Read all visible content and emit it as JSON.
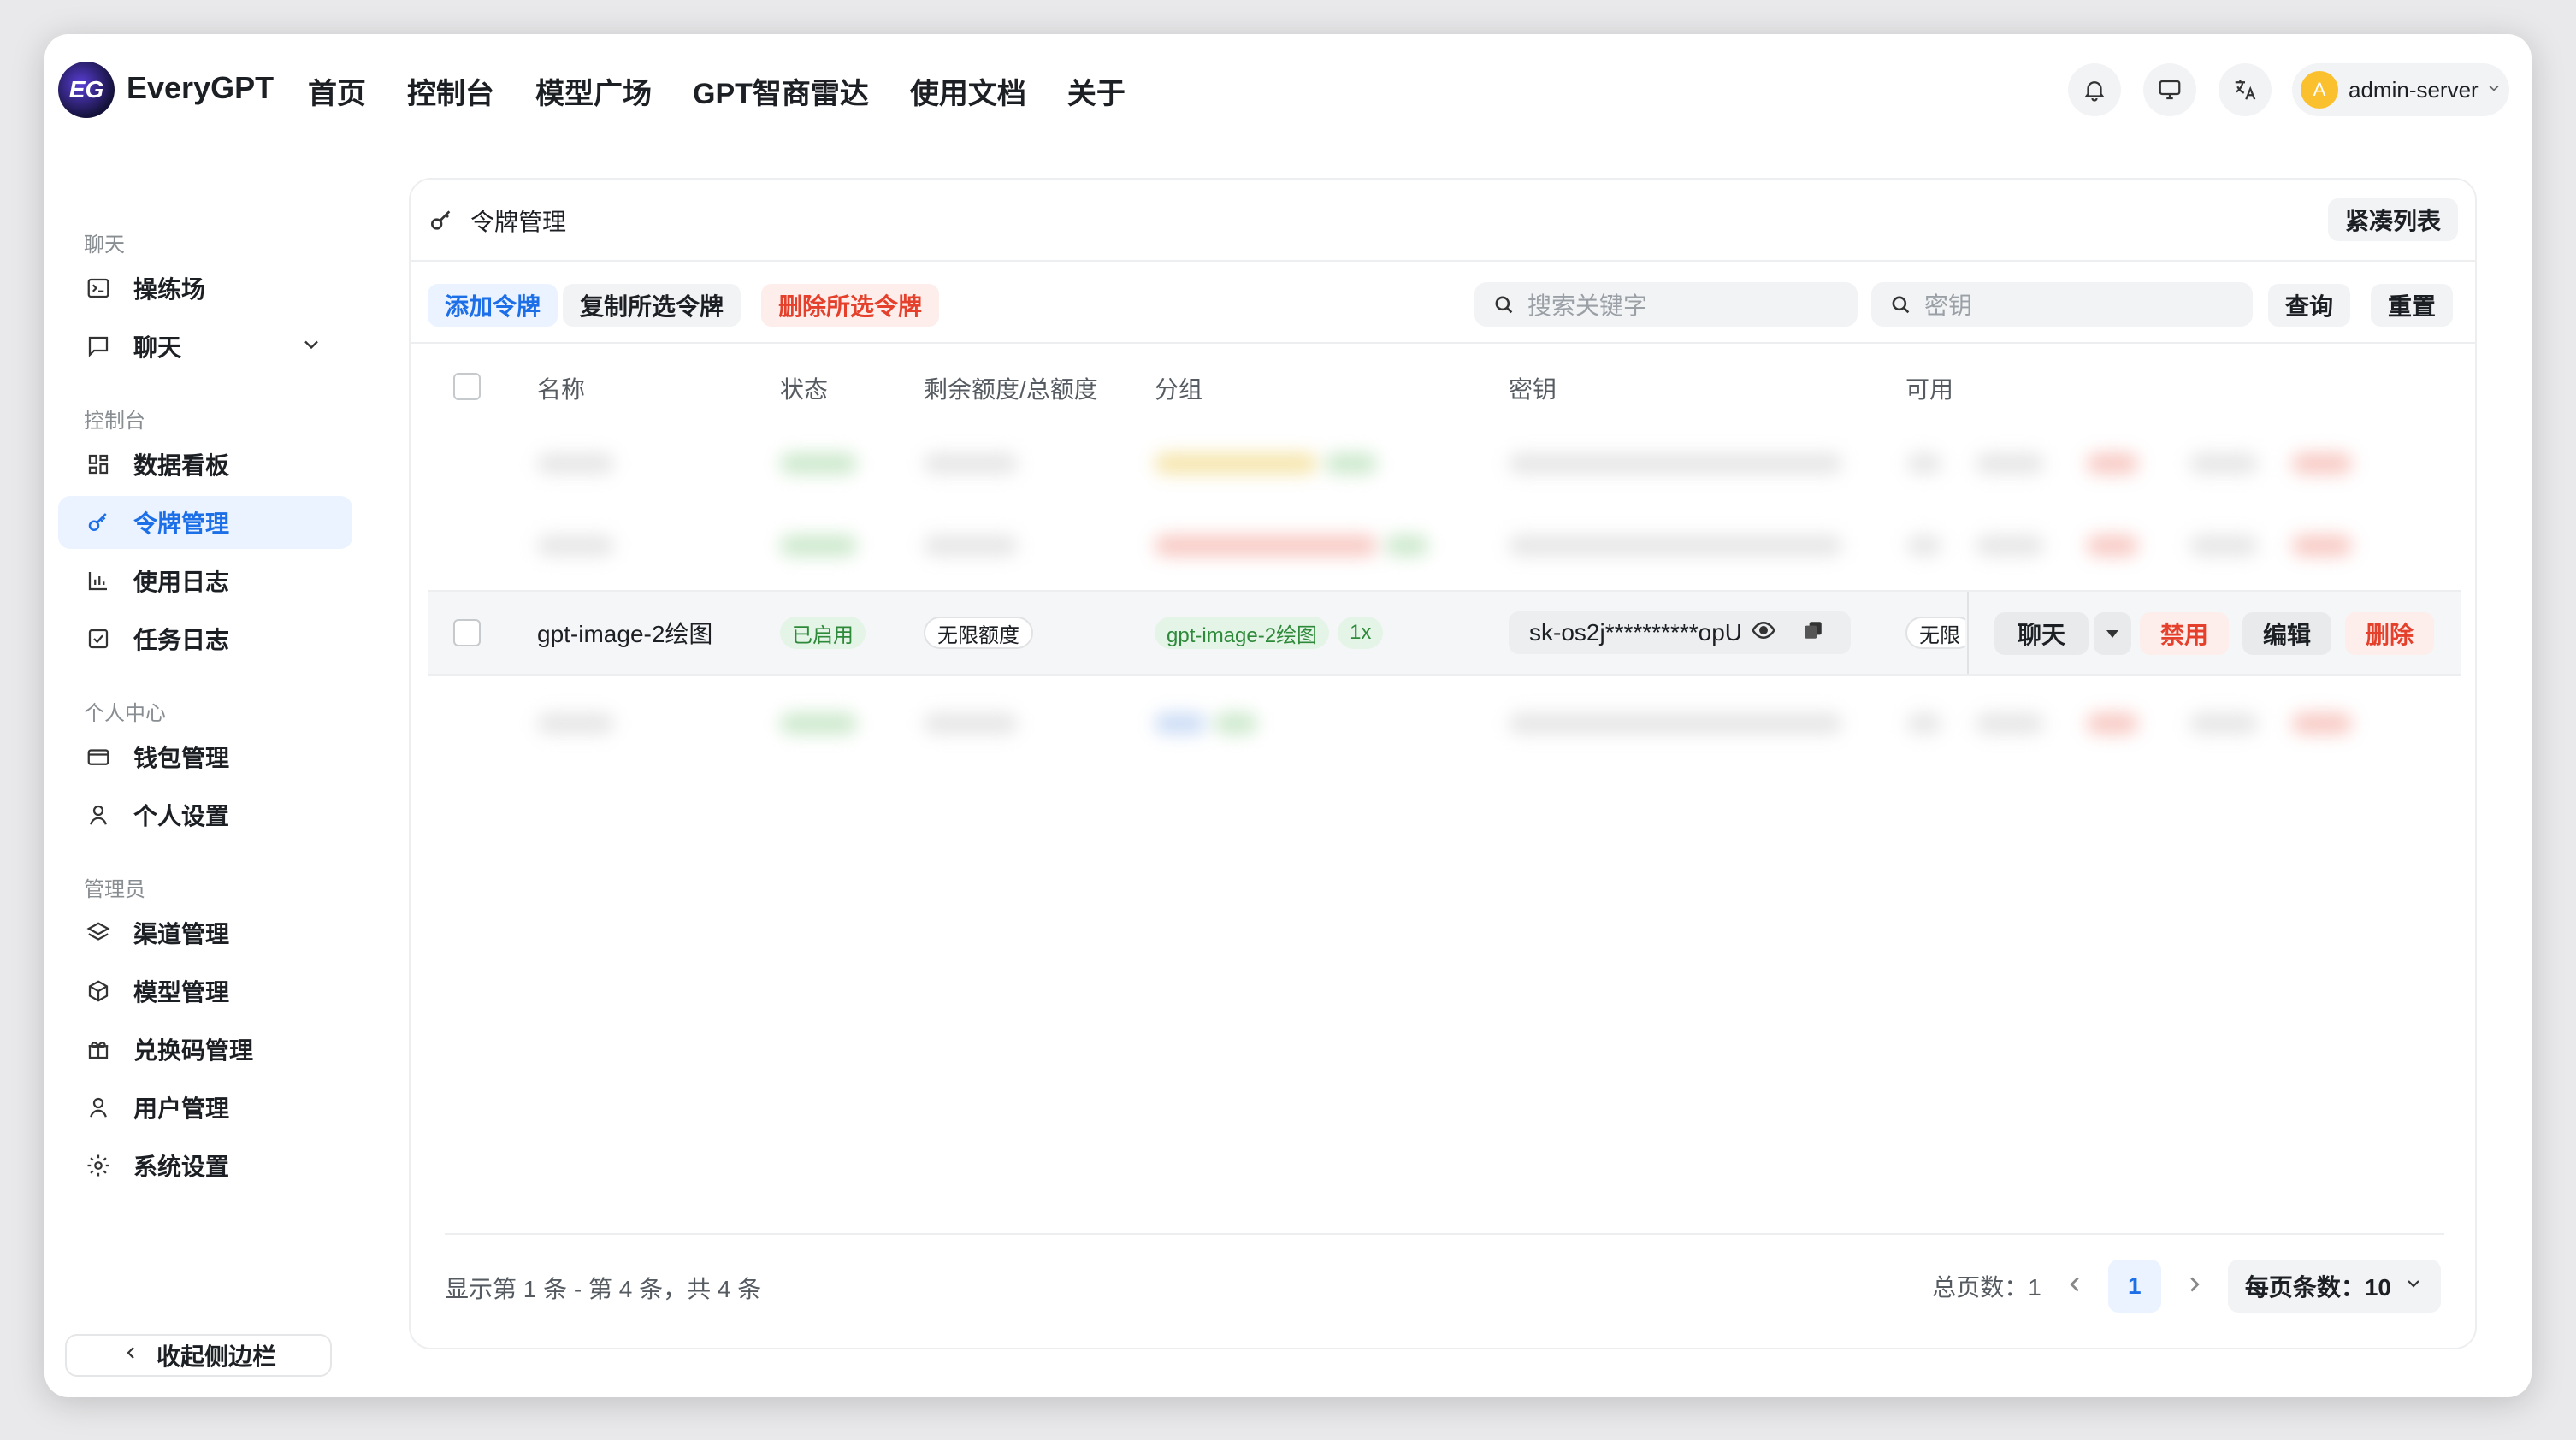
{
  "header": {
    "logo_text": "EG",
    "brand": "EveryGPT",
    "nav": [
      "首页",
      "控制台",
      "模型广场",
      "GPT智商雷达",
      "使用文档",
      "关于"
    ],
    "user_initial": "A",
    "username": "admin-server"
  },
  "sidebar": {
    "sections": {
      "chat": "聊天",
      "console": "控制台",
      "personal": "个人中心",
      "admin": "管理员"
    },
    "items": {
      "playground": "操练场",
      "chat": "聊天",
      "dashboard": "数据看板",
      "tokens": "令牌管理",
      "usage_log": "使用日志",
      "task_log": "任务日志",
      "wallet": "钱包管理",
      "settings_personal": "个人设置",
      "channels": "渠道管理",
      "models": "模型管理",
      "redeem": "兑换码管理",
      "users": "用户管理",
      "system": "系统设置"
    },
    "collapse": "收起侧边栏"
  },
  "card": {
    "title": "令牌管理",
    "compact": "紧凑列表"
  },
  "toolbar": {
    "add": "添加令牌",
    "copy": "复制所选令牌",
    "delete": "删除所选令牌",
    "search_placeholder": "搜索关键字",
    "key_placeholder": "密钥",
    "query": "查询",
    "reset": "重置"
  },
  "table": {
    "columns": [
      "名称",
      "状态",
      "剩余额度/总额度",
      "分组",
      "密钥",
      "可用"
    ],
    "row": {
      "name": "gpt-image-2绘图",
      "status": "已启用",
      "quota": "无限额度",
      "group": "gpt-image-2绘图",
      "ratio": "1x",
      "key": "sk-os2j**********opU",
      "models": "无限",
      "actions": {
        "chat": "聊天",
        "disable": "禁用",
        "edit": "编辑",
        "delete": "删除"
      }
    }
  },
  "footer": {
    "summary": "显示第 1 条 - 第 4 条，共 4 条",
    "total_pages_label": "总页数：1",
    "current_page": "1",
    "per_page": "每页条数：10"
  },
  "colors": {
    "accent": "#1d6fe8",
    "danger": "#e5402b",
    "success_bg": "#e4f4e6",
    "success_fg": "#2e8a3a"
  }
}
